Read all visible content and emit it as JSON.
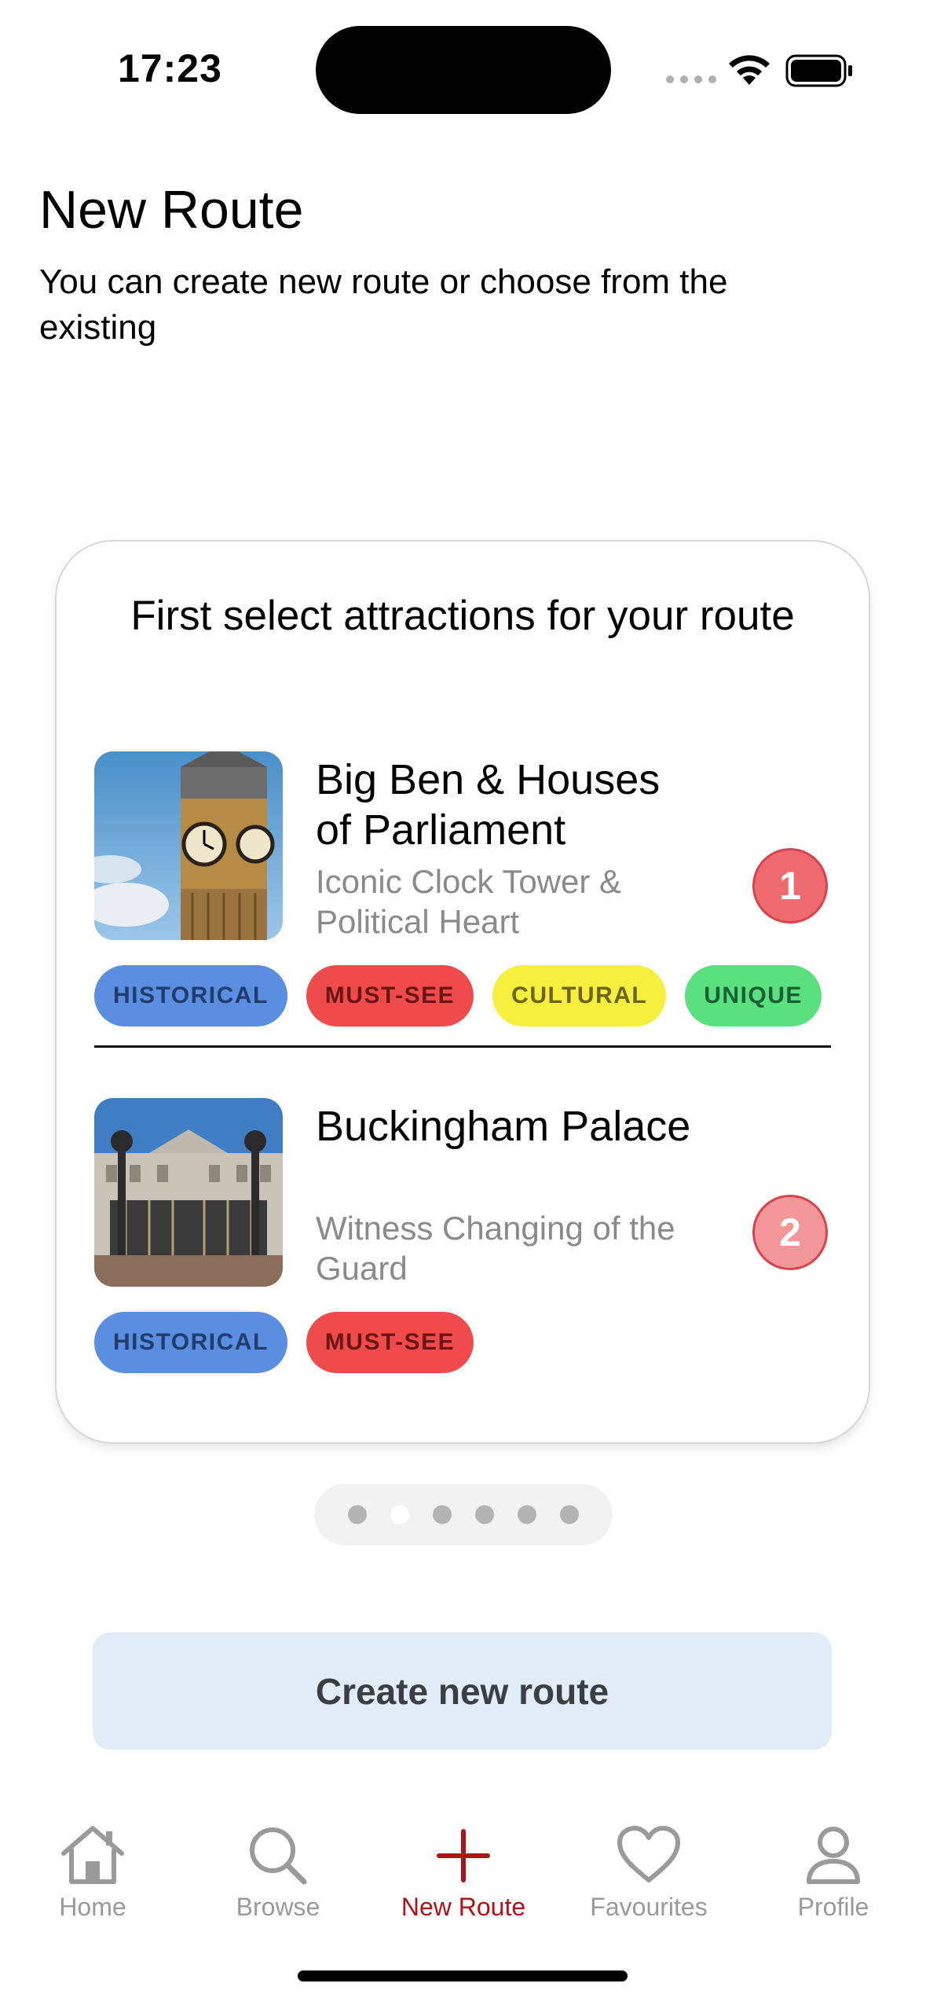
{
  "status_bar": {
    "time": "17:23",
    "icons": [
      "signal-icon",
      "wifi-icon",
      "battery-icon"
    ]
  },
  "header": {
    "title": "New Route",
    "subtitle": "You can create new route or choose from the existing"
  },
  "card": {
    "heading": "First select attractions for your route",
    "attractions": [
      {
        "name": "Big Ben & Houses of Parliament",
        "description": "Iconic Clock Tower & Political Heart",
        "order": "1",
        "tags": [
          "HISTORICAL",
          "MUST-SEE",
          "CULTURAL",
          "UNIQUE"
        ]
      },
      {
        "name": "Buckingham Palace",
        "description": "Witness Changing of the Guard",
        "order": "2",
        "tags": [
          "HISTORICAL",
          "MUST-SEE"
        ]
      }
    ]
  },
  "pagination": {
    "total": 6,
    "active_index": 1
  },
  "create_button": {
    "label": "Create new route"
  },
  "tab_bar": {
    "items": [
      {
        "label": "Home",
        "icon": "home-icon",
        "active": false
      },
      {
        "label": "Browse",
        "icon": "search-icon",
        "active": false
      },
      {
        "label": "New Route",
        "icon": "plus-icon",
        "active": true
      },
      {
        "label": "Favourites",
        "icon": "heart-icon",
        "active": false
      },
      {
        "label": "Profile",
        "icon": "person-icon",
        "active": false
      }
    ]
  },
  "colors": {
    "accent": "#b01217",
    "badge_1": "#ef6a6f",
    "badge_2": "#f4979b",
    "tag_historical": "#5b8de0",
    "tag_must_see": "#f04b4b",
    "tag_cultural": "#f6ef3e",
    "tag_unique": "#5be080",
    "create_button_bg": "#e1ecf6"
  }
}
